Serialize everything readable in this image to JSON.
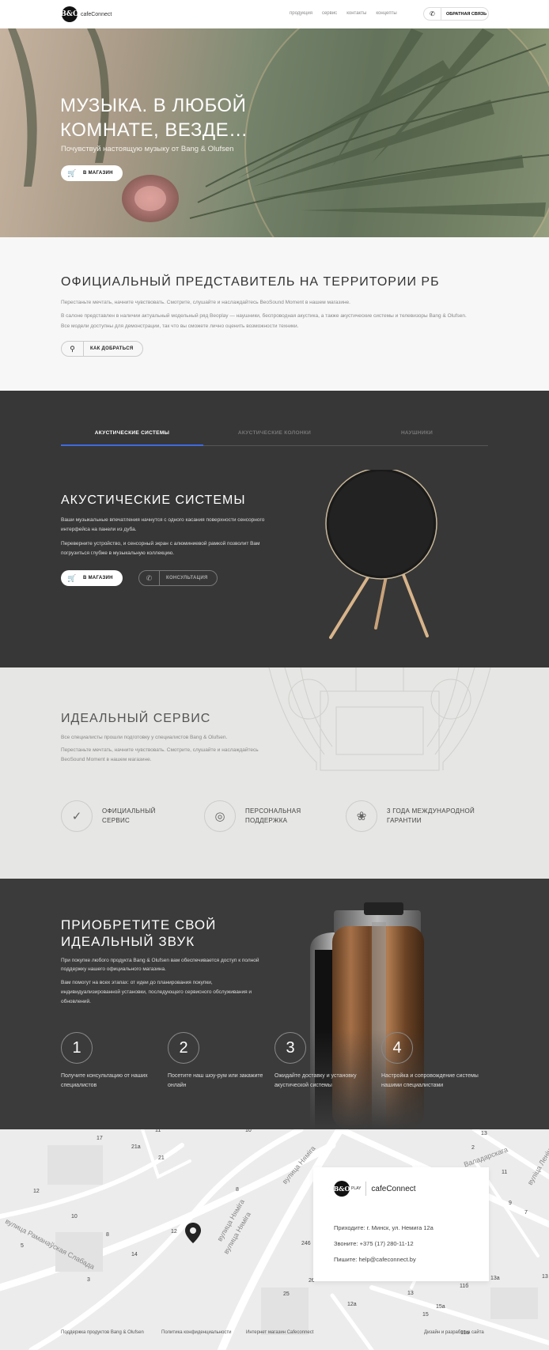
{
  "header": {
    "brand": "cafeConnect",
    "logo_mark": "B&O",
    "nav": [
      "продукция",
      "сервис",
      "контакты",
      "концепты"
    ],
    "callback_label": "ОБРАТНАЯ СВЯЗЬ"
  },
  "hero": {
    "title": "МУЗЫКА. В ЛЮБОЙ КОМНАТЕ, ВЕЗДЕ…",
    "subtitle": "Почувствуй настоящую музыку от Bang & Olufsen",
    "button_label": "В МАГАЗИН"
  },
  "official": {
    "title": "ОФИЦИАЛЬНЫЙ ПРЕДСТАВИТЕЛЬ НА ТЕРРИТОРИИ РБ",
    "p1": "Перестаньте мечтать, начните чувствовать. Смотрите, слушайте и наслаждайтесь BeoSound Moment в нашем магазине.",
    "p2": "В салоне представлен в наличии актуальный модельный ряд Beoplay — наушники, беспроводная акустика, а также акустические системы и телевизоры Bang & Olufsen. Все модели доступны для демонстрации, так что вы сможете лично оценить возможности техники.",
    "button_label": "КАК ДОБРАТЬСЯ"
  },
  "acoustic": {
    "tabs": [
      "АКУСТИЧЕСКИЕ СИСТЕМЫ",
      "АКУСТИЧЕСКИЕ КОЛОНКИ",
      "НАУШНИКИ"
    ],
    "title": "АКУСТИЧЕСКИЕ СИСТЕМЫ",
    "p1": "Ваши музыкальные впечатления начнутся с одного касания поверхности сенсорного интерфейса на панели из дуба.",
    "p2": "Переверните устройство, и сенсорный экран с алюминиевой рамкой позволит Вам погрузиться глубже в музыкальную коллекцию.",
    "shop_label": "В МАГАЗИН",
    "consult_label": "КОНСУЛЬТАЦИЯ"
  },
  "service": {
    "title": "ИДЕАЛЬНЫЙ СЕРВИС",
    "p1": "Все специалисты прошли подготовку у специалистов Bang & Olufsen.",
    "p2": "Перестаньте мечтать, начните чувствовать. Смотрите, слушайте и наслаждайтесь BeoSound Moment в нашем магазине.",
    "features": [
      {
        "line1": "ОФИЦИАЛЬНЫЙ",
        "line2": "СЕРВИС"
      },
      {
        "line1": "ПЕРСОНАЛЬНАЯ",
        "line2": "ПОДДЕРЖКА"
      },
      {
        "line1": "3 ГОДА МЕЖДУНАРОДНОЙ",
        "line2": "ГАРАНТИИ"
      }
    ]
  },
  "buy": {
    "title": "ПРИОБРЕТИТЕ СВОЙ ИДЕАЛЬНЫЙ ЗВУК",
    "p1": "При покупке любого продукта Bang & Olufsen вам обеспечивается доступ к полной поддержку нашего официального магазина.",
    "p2": "Вам помогут на всех этапах: от идеи до планирования покупки, индивидуализированной установки, последующего сервисного обслуживания и обновлений.",
    "steps": [
      {
        "num": "1",
        "text": "Получите консультацию от наших специалистов"
      },
      {
        "num": "2",
        "text": "Посетите наш шоу-рум или закажите онлайн"
      },
      {
        "num": "3",
        "text": "Ожидайте доставку и установку акустической системы"
      },
      {
        "num": "4",
        "text": "Настройка и сопровождение системы нашими специалистами"
      }
    ]
  },
  "map": {
    "streets": [
      "вулица Няміга",
      "вулица Раманаўская Слабада",
      "вулица Няміга",
      "вулица Няміга",
      "Валадарскага",
      "вуліца Леніна"
    ],
    "numbers": [
      "17",
      "11",
      "10",
      "21a",
      "21",
      "12",
      "8",
      "10",
      "8",
      "12",
      "14",
      "5",
      "246",
      "13",
      "2",
      "11",
      "9",
      "7",
      "3",
      "26",
      "25",
      "12a",
      "13",
      "13a",
      "13",
      "15",
      "11б",
      "15a",
      "11a"
    ]
  },
  "contact_card": {
    "brand": "cafeConnect",
    "mark": "B&O",
    "play": "PLAY",
    "address": "Приходите: г. Минск, ул. Немига 12а",
    "phone": "Звоните: +375 (17) 280-11-12",
    "email": "Пишите: help@cafeconnect.by"
  },
  "footer": {
    "links": [
      "Поддержка продуктов Bang & Olufsen",
      "Политика конфиденциальности",
      "Интернет магазин Cafeconnect"
    ],
    "credit": "Дизайн и разработка сайта"
  }
}
